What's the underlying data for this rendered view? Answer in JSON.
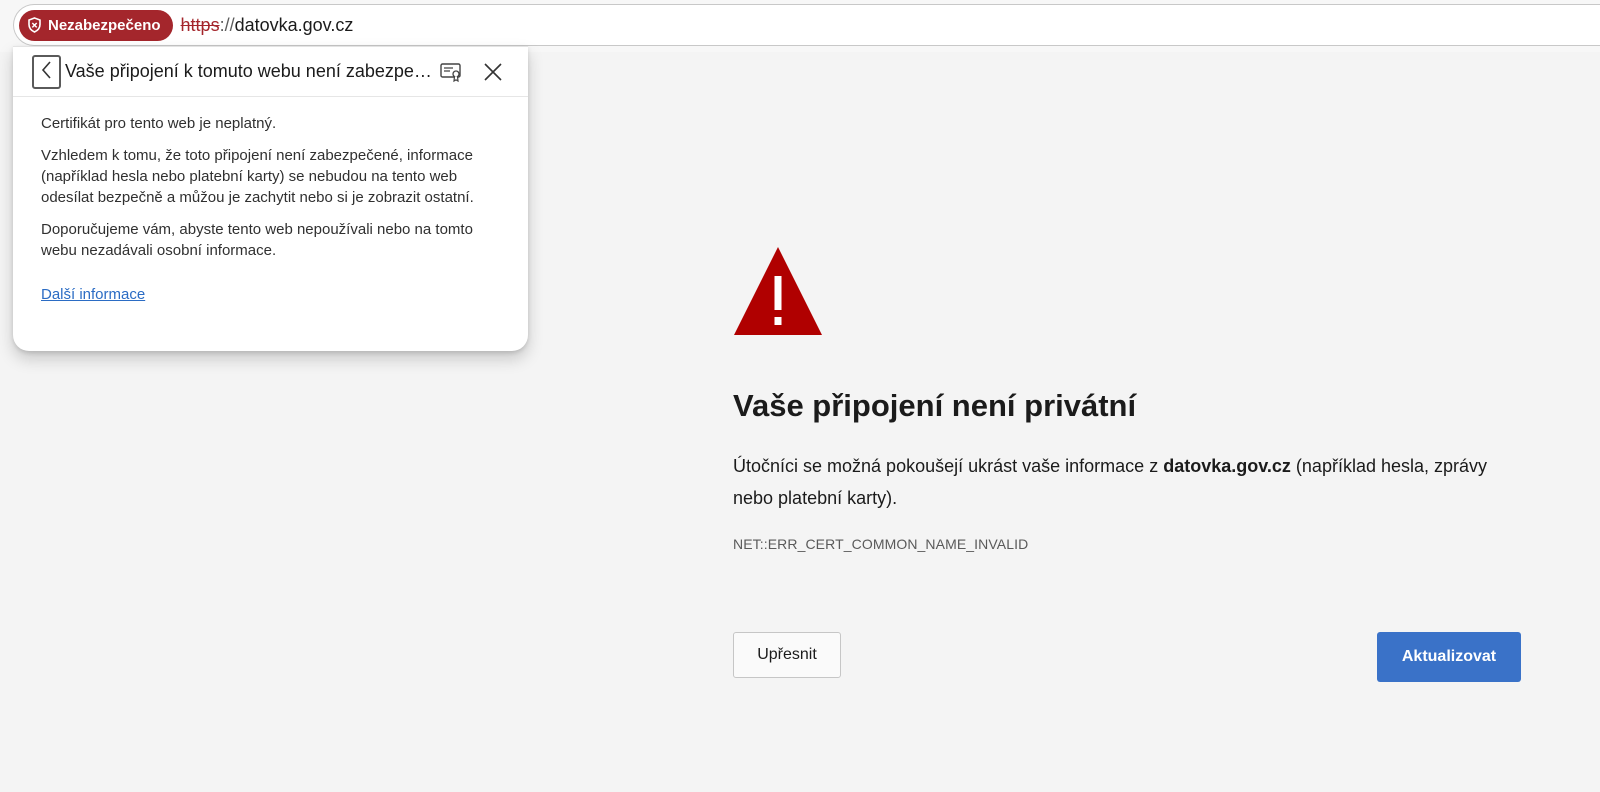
{
  "address_bar": {
    "security_label": "Nezabezpečeno",
    "url_scheme": "https",
    "url_separator": "://",
    "url_host": "datovka.gov.cz"
  },
  "flyout": {
    "title": "Vaše připojení k tomuto webu není zabezpečené",
    "paragraphs": [
      "Certifikát pro tento web je neplatný.",
      "Vzhledem k tomu, že toto připojení není zabezpečené, informace (například hesla nebo platební karty) se nebudou na tento web odesílat bezpečně a můžou je zachytit nebo si je zobrazit ostatní.",
      "Doporučujeme vám, abyste tento web nepoužívali nebo na tomto webu nezadávali osobní informace."
    ],
    "link_label": "Další informace"
  },
  "error_page": {
    "heading": "Vaše připojení není privátní",
    "description_before": "Útočníci se možná pokoušejí ukrást vaše informace z ",
    "description_host": "datovka.gov.cz",
    "description_after": " (například hesla, zprávy nebo platební karty).",
    "error_code": "NET::ERR_CERT_COMMON_NAME_INVALID",
    "details_button": "Upřesnit",
    "refresh_button": "Aktualizovat"
  },
  "colors": {
    "danger": "#a4262c",
    "warning_triangle": "#b00000",
    "primary_button": "#3a72c8",
    "link": "#2b6cc4"
  },
  "icons": {
    "security": "shield-alert-icon",
    "back": "chevron-left-icon",
    "certificate": "certificate-icon",
    "close": "close-icon",
    "warning": "warning-triangle-icon"
  }
}
